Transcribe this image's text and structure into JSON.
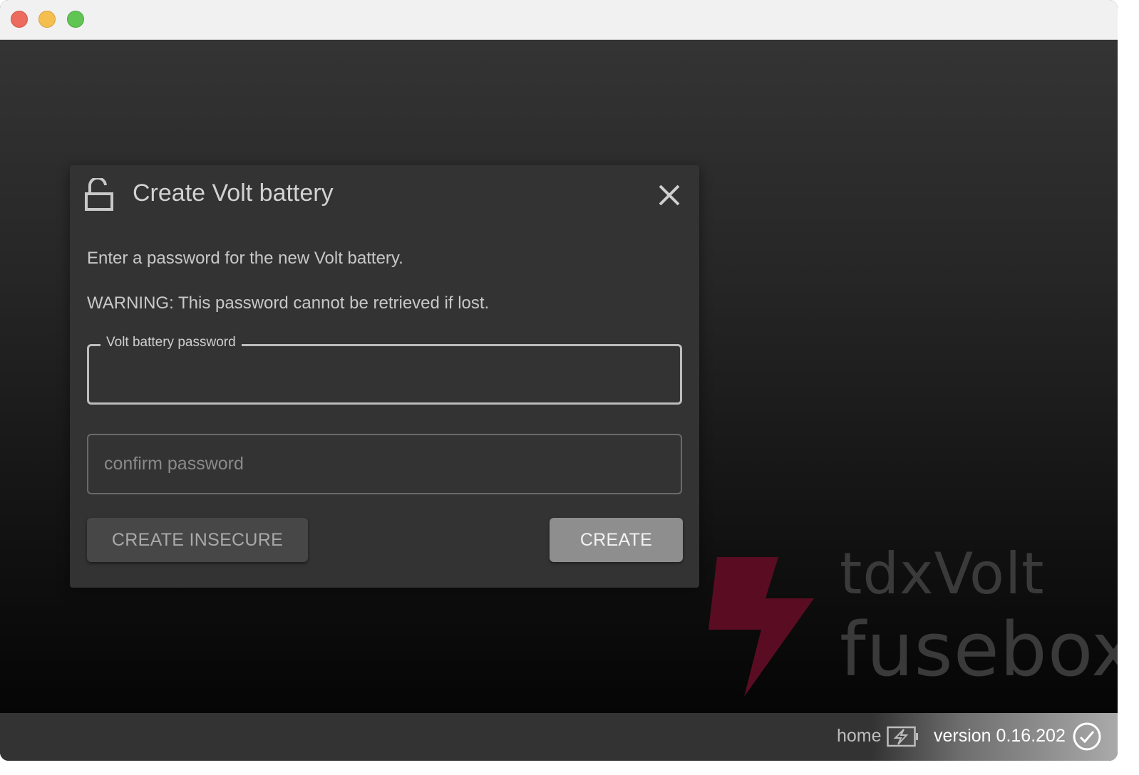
{
  "window": {
    "traffic_lights": [
      "close",
      "minimize",
      "zoom"
    ]
  },
  "dialog": {
    "title": "Create Volt battery",
    "icon": "unlock-icon",
    "message": "Enter a password for the new Volt battery.",
    "warning": "WARNING: This password cannot be retrieved if lost.",
    "password_field": {
      "label": "Volt battery password",
      "value": ""
    },
    "confirm_field": {
      "placeholder": "confirm password",
      "value": ""
    },
    "buttons": {
      "insecure_label": "CREATE INSECURE",
      "create_label": "CREATE"
    }
  },
  "branding": {
    "line1": "tdxVolt",
    "line2": "fusebox",
    "bolt_color": "#5a0d22"
  },
  "statusbar": {
    "location": "home",
    "version": "version 0.16.202"
  }
}
